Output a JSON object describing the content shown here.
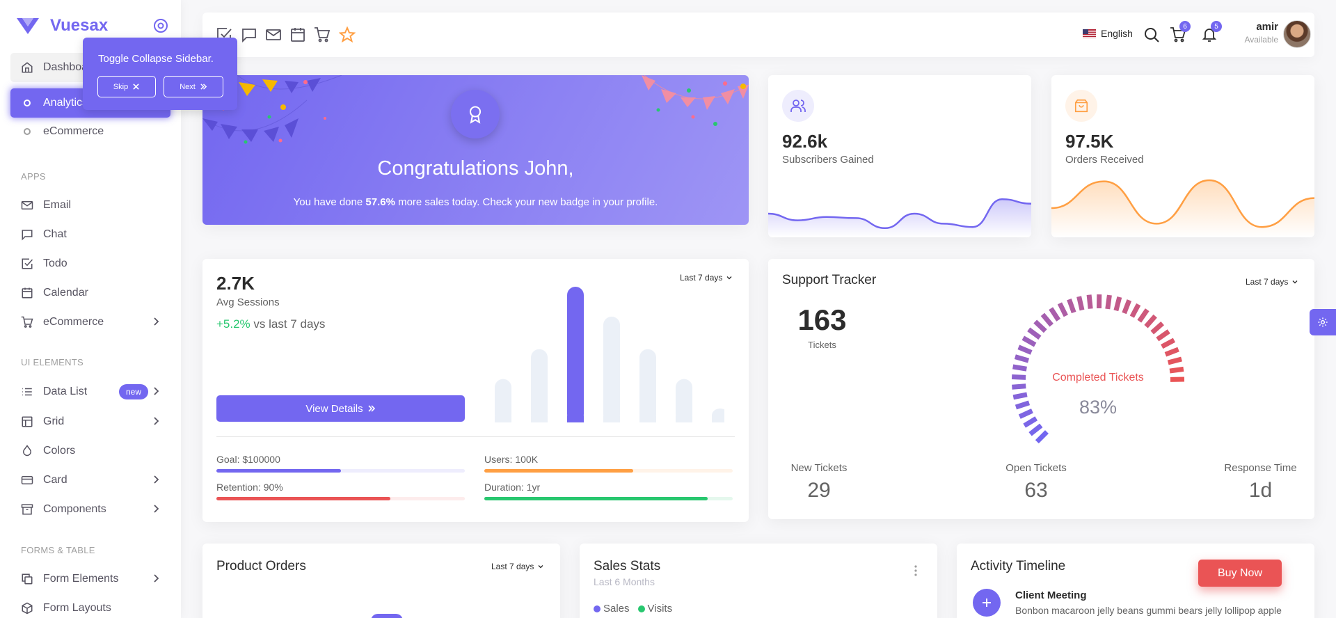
{
  "brand": {
    "name": "Vuesax"
  },
  "tour": {
    "text": "Toggle Collapse Sidebar.",
    "skip": "Skip",
    "next": "Next"
  },
  "sidebar": {
    "dashboard": "Dashboard",
    "analytics": "Analytics",
    "ecommerce_sub": "eCommerce",
    "sections": {
      "apps": "APPS",
      "ui": "UI ELEMENTS",
      "forms": "FORMS & TABLE"
    },
    "items": {
      "email": "Email",
      "chat": "Chat",
      "todo": "Todo",
      "calendar": "Calendar",
      "ecommerce": "eCommerce",
      "data_list": "Data List",
      "data_list_badge": "new",
      "grid": "Grid",
      "colors": "Colors",
      "card": "Card",
      "components": "Components",
      "form_elements": "Form Elements",
      "form_layouts": "Form Layouts"
    }
  },
  "navbar": {
    "language": "English",
    "cart_count": "6",
    "notif_count": "5",
    "user_name": "amir",
    "user_status": "Available"
  },
  "hero": {
    "title": "Congratulations John,",
    "sub_pre": "You have done ",
    "sub_strong": "57.6%",
    "sub_post": " more sales today. Check your new badge in your profile."
  },
  "subscribers": {
    "value": "92.6k",
    "label": "Subscribers Gained",
    "color": "#7367f0",
    "trend": [
      30,
      18,
      24,
      22,
      4,
      30,
      12,
      6,
      56,
      48
    ]
  },
  "orders": {
    "value": "97.5K",
    "label": "Orders Received",
    "color": "#ff9f43",
    "trend": [
      40,
      88,
      12,
      90,
      6,
      58
    ]
  },
  "sessions": {
    "value": "2.7K",
    "label": "Avg Sessions",
    "change": "+5.2%",
    "change_suffix": " vs last 7 days",
    "period": "Last 7 days",
    "button": "View Details",
    "bars": [
      0.32,
      0.54,
      1.0,
      0.78,
      0.54,
      0.32,
      0.1
    ],
    "highlight_index": 2,
    "metrics": [
      {
        "label": "Goal: $100000",
        "pct": 0.5,
        "color": "#7367f0",
        "bg": "#eeedfd"
      },
      {
        "label": "Users: 100K",
        "pct": 0.6,
        "color": "#ff9f43",
        "bg": "#fff3e8"
      },
      {
        "label": "Retention: 90%",
        "pct": 0.7,
        "color": "#ea5455",
        "bg": "#fdecec"
      },
      {
        "label": "Duration: 1yr",
        "pct": 0.9,
        "color": "#28c76f",
        "bg": "#e5f8ed"
      }
    ]
  },
  "support": {
    "title": "Support Tracker",
    "period": "Last 7 days",
    "tickets_value": "163",
    "tickets_label": "Tickets",
    "gauge_label": "Completed Tickets",
    "gauge_value": "83%",
    "gauge_pct": 0.83,
    "footer": [
      {
        "label": "New Tickets",
        "value": "29"
      },
      {
        "label": "Open Tickets",
        "value": "63"
      },
      {
        "label": "Response Time",
        "value": "1d"
      }
    ]
  },
  "product_orders": {
    "title": "Product Orders",
    "period": "Last 7 days"
  },
  "sales_stats": {
    "title": "Sales Stats",
    "subtitle": "Last 6 Months",
    "legend": [
      "Sales",
      "Visits"
    ]
  },
  "activity": {
    "title": "Activity Timeline",
    "buy_now": "Buy Now",
    "item_title": "Client Meeting",
    "item_text": "Bonbon macaroon jelly beans gummi bears jelly lollipop apple"
  }
}
